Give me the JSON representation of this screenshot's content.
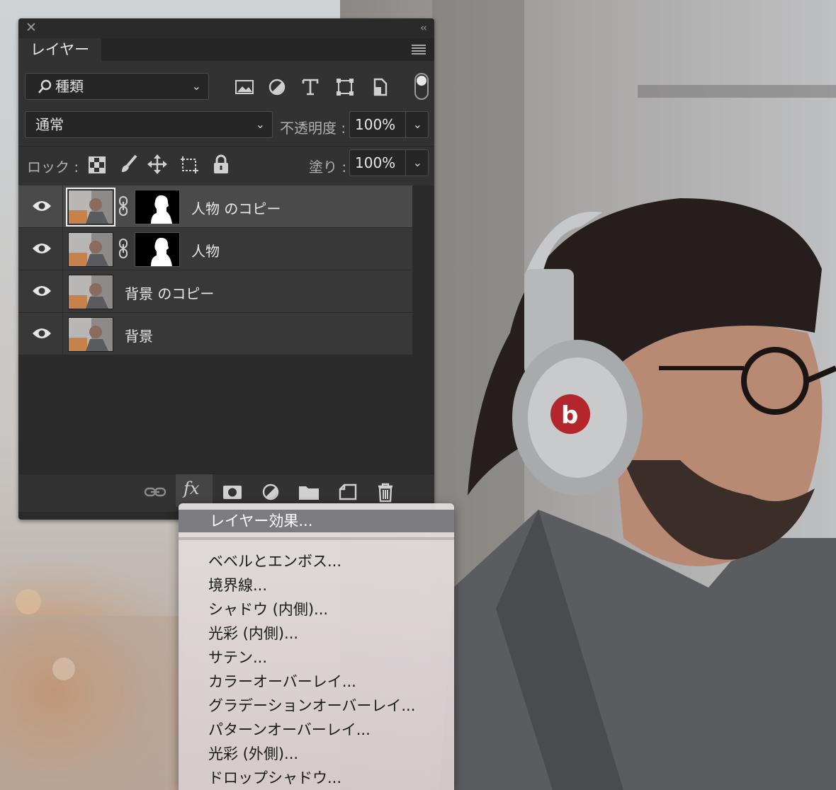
{
  "panel": {
    "close_glyph": "✕",
    "collapse_glyph": "‹‹",
    "tab_label": "レイヤー",
    "kind_filter": "種類",
    "blend_mode": "通常",
    "opacity_label": "不透明度 :",
    "opacity_value": "100%",
    "lock_label": "ロック :",
    "fill_label": "塗り :",
    "fill_value": "100%"
  },
  "layers": [
    {
      "name": "人物 のコピー",
      "visible": true,
      "selected": true,
      "has_mask": true
    },
    {
      "name": "人物",
      "visible": true,
      "selected": false,
      "has_mask": true
    },
    {
      "name": "背景 のコピー",
      "visible": true,
      "selected": false,
      "has_mask": false
    },
    {
      "name": "背景",
      "visible": true,
      "selected": false,
      "has_mask": false
    }
  ],
  "bottom_bar": {
    "icons": [
      "link-layers-icon",
      "fx-icon",
      "add-mask-icon",
      "adjustment-layer-icon",
      "new-group-icon",
      "new-layer-icon",
      "delete-icon"
    ],
    "fx_label": "fx"
  },
  "fx_menu": {
    "title_item": "レイヤー効果...",
    "items": [
      "ベベルとエンボス...",
      "境界線...",
      "シャドウ (内側)...",
      "光彩 (内側)...",
      "サテン...",
      "カラーオーバーレイ...",
      "グラデーションオーバーレイ...",
      "パターンオーバーレイ...",
      "光彩 (外側)...",
      "ドロップシャドウ..."
    ]
  },
  "colors": {
    "panel_bg": "#323232",
    "row_bg": "#383838",
    "row_selected": "#4a4a4a",
    "menu_highlight": "#7b7b80",
    "logo_red": "#b3262b"
  }
}
